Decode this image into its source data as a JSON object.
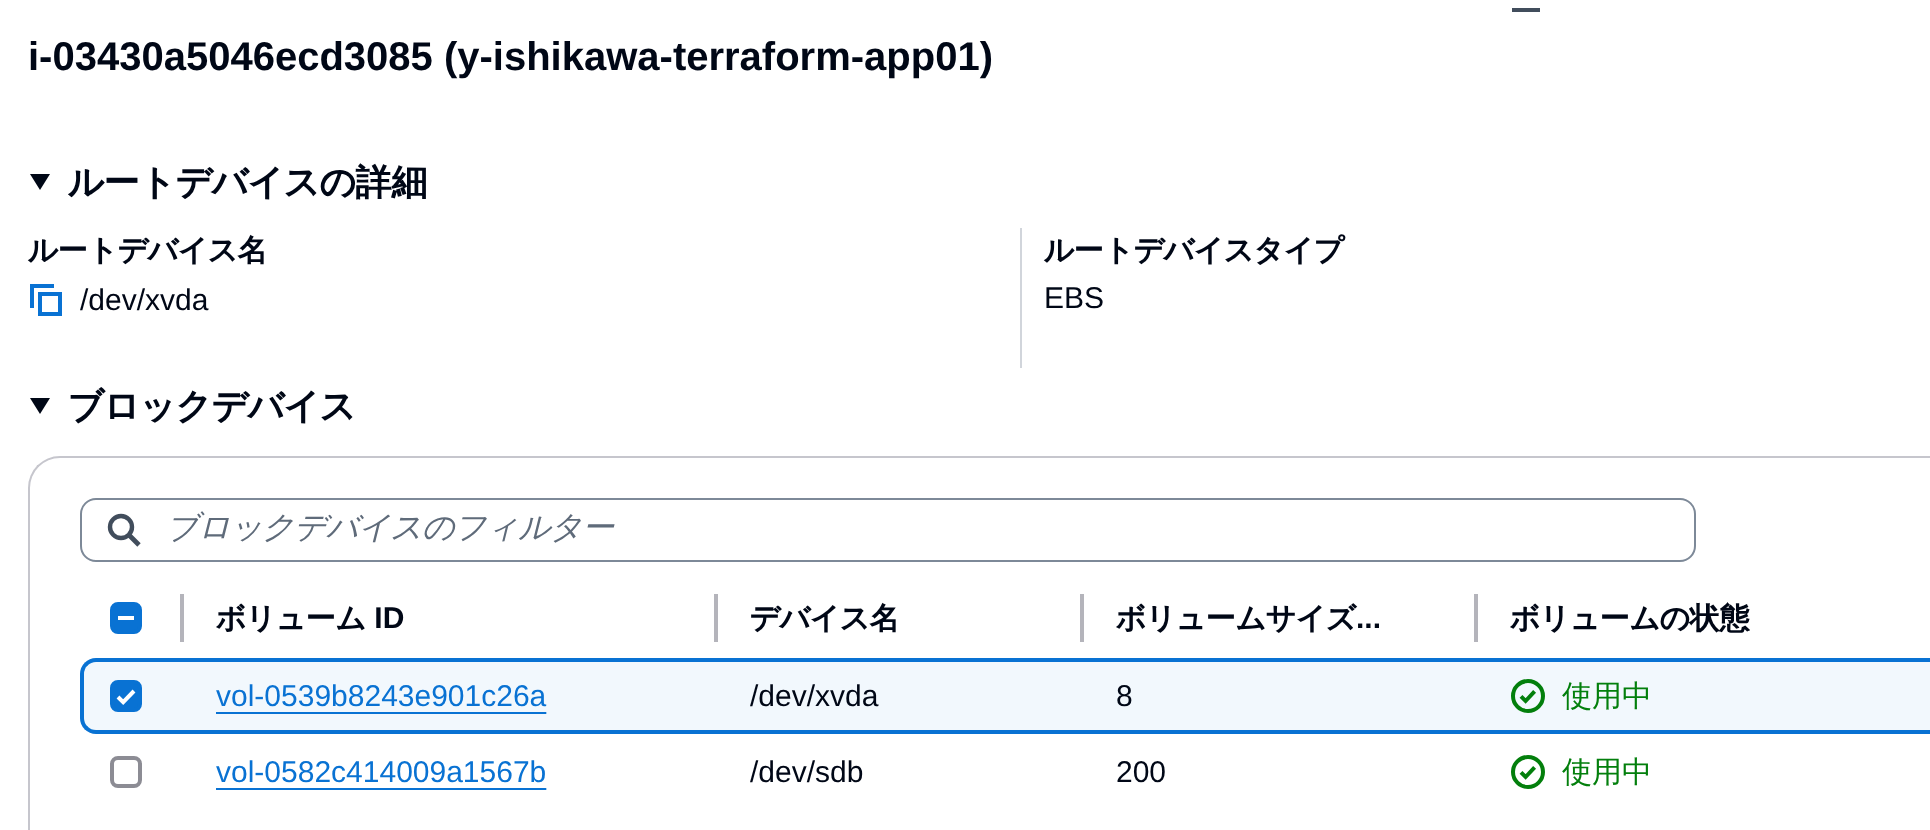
{
  "title": "i-03430a5046ecd3085 (y-ishikawa-terraform-app01)",
  "root_device": {
    "heading": "ルートデバイスの詳細",
    "expanded": true,
    "fields": [
      {
        "label": "ルートデバイス名",
        "value": "/dev/xvda",
        "copyable": true
      },
      {
        "label": "ルートデバイスタイプ",
        "value": "EBS",
        "copyable": false
      }
    ]
  },
  "block_devices": {
    "heading": "ブロックデバイス",
    "expanded": true,
    "filter": {
      "placeholder": "ブロックデバイスのフィルター"
    },
    "select_all": {
      "indeterminate": true
    },
    "columns": [
      "ボリューム ID",
      "デバイス名",
      "ボリュームサイズ...",
      "ボリュームの状態"
    ],
    "rows": [
      {
        "selected": true,
        "volume_id": "vol-0539b8243e901c26a",
        "device": "/dev/xvda",
        "size": "8",
        "status": "使用中"
      },
      {
        "selected": false,
        "volume_id": "vol-0582c414009a1567b",
        "device": "/dev/sdb",
        "size": "200",
        "status": "使用中"
      }
    ]
  }
}
